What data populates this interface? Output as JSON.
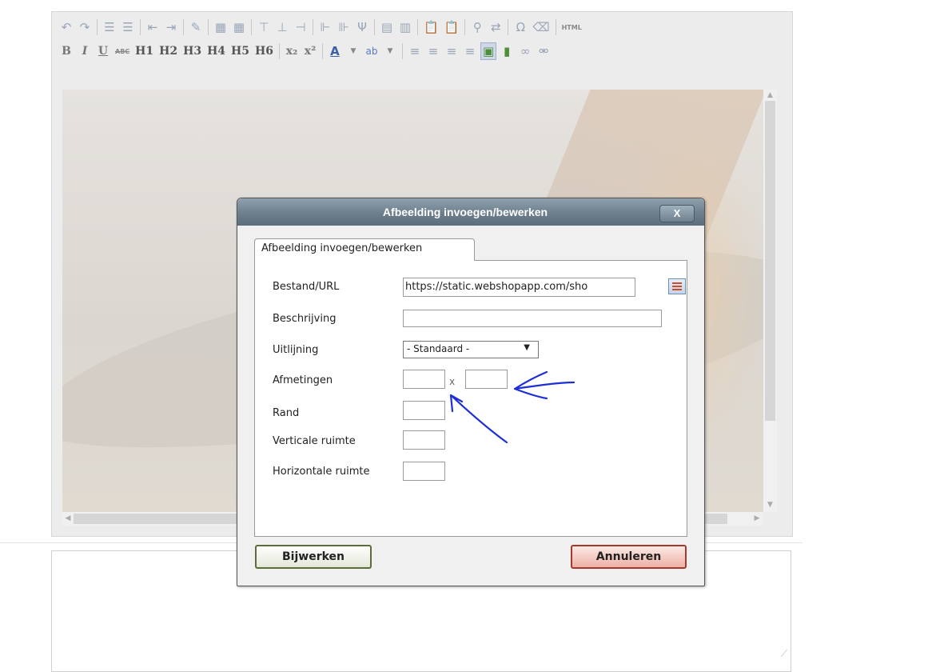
{
  "toolbar": {
    "row2_labels": {
      "bold": "B",
      "italic": "I",
      "underline": "U",
      "strike": "ABC",
      "h1": "H1",
      "h2": "H2",
      "h3": "H3",
      "h4": "H4",
      "h5": "H5",
      "h6": "H6",
      "subscript": "x₂",
      "superscript": "x²",
      "html": "HTML"
    }
  },
  "dialog": {
    "title": "Afbeelding invoegen/bewerken",
    "close_label": "X",
    "tab_label": "Afbeelding invoegen/bewerken",
    "fields": {
      "url_label": "Bestand/URL",
      "url_value": "https://static.webshopapp.com/sho",
      "description_label": "Beschrijving",
      "description_value": "",
      "alignment_label": "Uitlijning",
      "alignment_value": "- Standaard -",
      "dimensions_label": "Afmetingen",
      "dimensions_separator": "x",
      "width_value": "",
      "height_value": "",
      "border_label": "Rand",
      "border_value": "",
      "vspace_label": "Verticale ruimte",
      "vspace_value": "",
      "hspace_label": "Horizontale ruimte",
      "hspace_value": ""
    },
    "update_button": "Bijwerken",
    "cancel_button": "Annuleren"
  },
  "colors": {
    "annotation": "#1f2fd6",
    "title_bar": "#6d7f8d",
    "cancel_border": "#a23a2e",
    "update_border": "#5a6e3a"
  }
}
